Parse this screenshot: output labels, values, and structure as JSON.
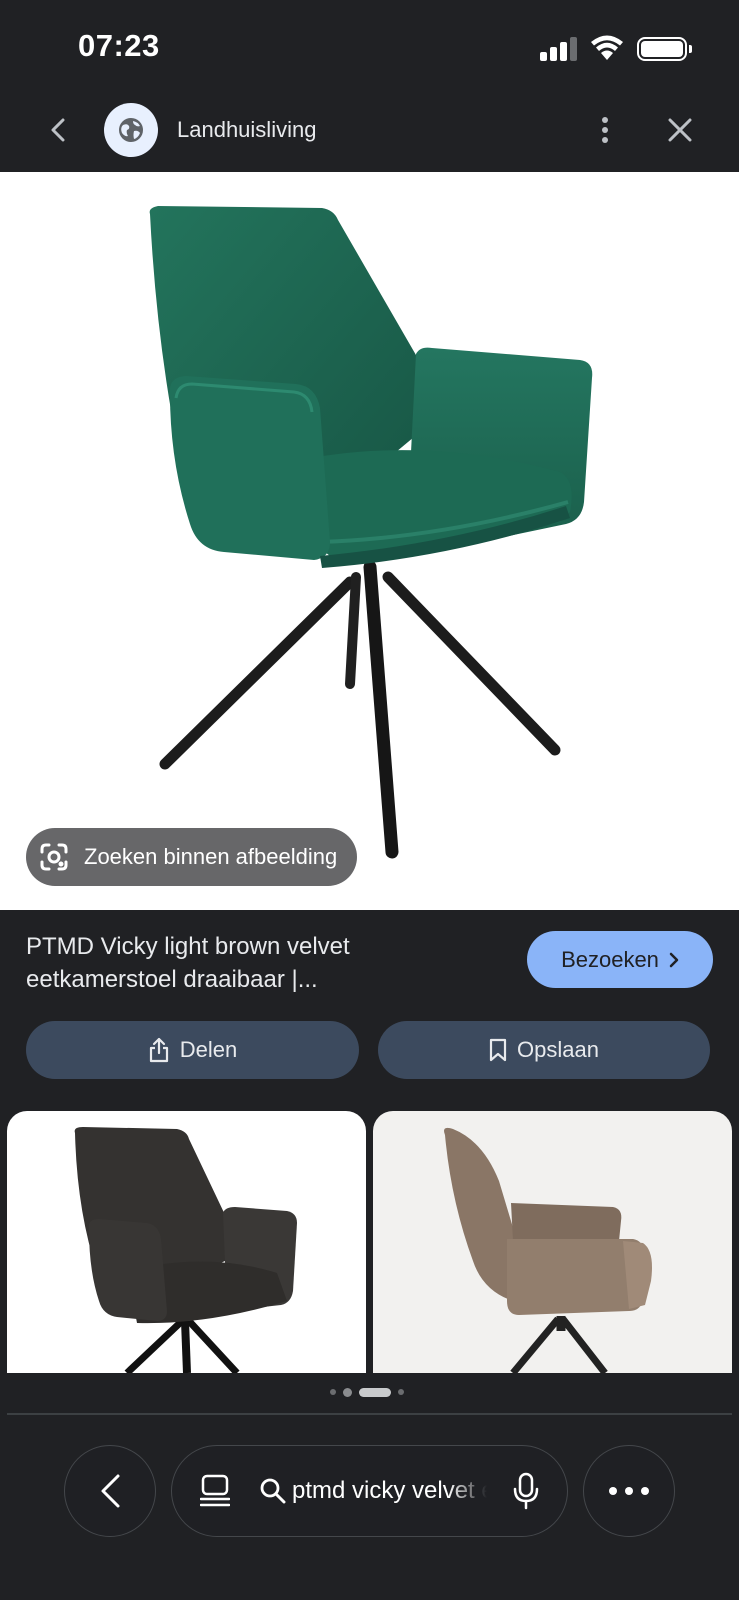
{
  "status_bar": {
    "time": "07:23"
  },
  "header": {
    "site_name": "Landhuisliving"
  },
  "main_image": {
    "lens_label": "Zoeken binnen afbeelding"
  },
  "result": {
    "title": "PTMD Vicky light brown velvet eetkamerstoel draaibaar |...",
    "visit_label": "Bezoeken"
  },
  "actions": {
    "share_label": "Delen",
    "save_label": "Opslaan"
  },
  "carousel": {
    "dots": 4,
    "active_index": 2
  },
  "toolbar": {
    "query": "ptmd vicky velvet eetkamerstoel"
  },
  "colors": {
    "background": "#202124",
    "accent": "#8ab4f8",
    "action_button": "#3c4a5e",
    "chair_green": "#1f6b55",
    "chair_dark": "#2e2c2b",
    "chair_brown": "#8d7a6b"
  },
  "icons": [
    "back-icon",
    "globe-icon",
    "more-vert-icon",
    "close-icon",
    "lens-icon",
    "chevron-right-icon",
    "share-icon",
    "bookmark-icon",
    "tabs-icon",
    "search-icon",
    "mic-icon",
    "more-horiz-icon"
  ]
}
